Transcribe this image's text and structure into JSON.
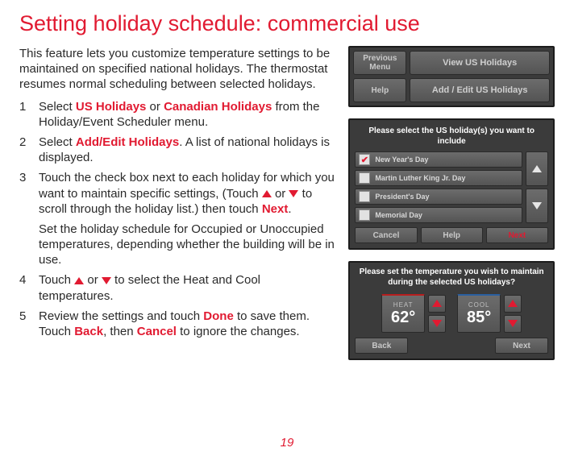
{
  "title": "Setting holiday schedule: commercial use",
  "intro": "This feature lets you customize temperature settings to be maintained on specified national holidays. The thermostat resumes normal scheduling between selected holidays.",
  "steps": {
    "s1a": "Select ",
    "s1b": "US Holidays",
    "s1c": " or ",
    "s1d": "Canadian Holidays",
    "s1e": " from the Holiday/Event Scheduler menu.",
    "s2a": "Select ",
    "s2b": "Add/Edit Holidays",
    "s2c": ". A list of national holidays is displayed.",
    "s3a": "Touch the check box next to each holiday for which you want to maintain specific settings, (Touch ",
    "s3b": " or ",
    "s3c": " to scroll through the holiday list.) then touch ",
    "s3d": "Next",
    "s3e": ".",
    "s3sub": "Set the holiday schedule for Occupied or Unoccupied temperatures, depending whether the building will be in use.",
    "s4a": "Touch ",
    "s4b": " or ",
    "s4c": " to select the Heat and Cool temperatures.",
    "s5a": "Review the settings and touch ",
    "s5b": "Done",
    "s5c": " to save them. Touch ",
    "s5d": "Back",
    "s5e": ", then ",
    "s5f": "Cancel",
    "s5g": " to ignore the changes."
  },
  "panel1": {
    "previous_menu": "Previous Menu",
    "help": "Help",
    "view": "View US Holidays",
    "add_edit": "Add / Edit US Holidays"
  },
  "panel2": {
    "prompt": "Please select the US holiday(s) you want to include",
    "items": [
      {
        "label": "New Year's Day",
        "checked": true
      },
      {
        "label": "Martin Luther King Jr. Day",
        "checked": false
      },
      {
        "label": "President's Day",
        "checked": false
      },
      {
        "label": "Memorial Day",
        "checked": false
      }
    ],
    "cancel": "Cancel",
    "help": "Help",
    "next": "Next"
  },
  "panel3": {
    "prompt": "Please set the temperature you wish to maintain during the selected US holidays?",
    "heat_label": "HEAT",
    "heat_value": "62°",
    "cool_label": "COOL",
    "cool_value": "85°",
    "back": "Back",
    "next": "Next"
  },
  "page_number": "19"
}
